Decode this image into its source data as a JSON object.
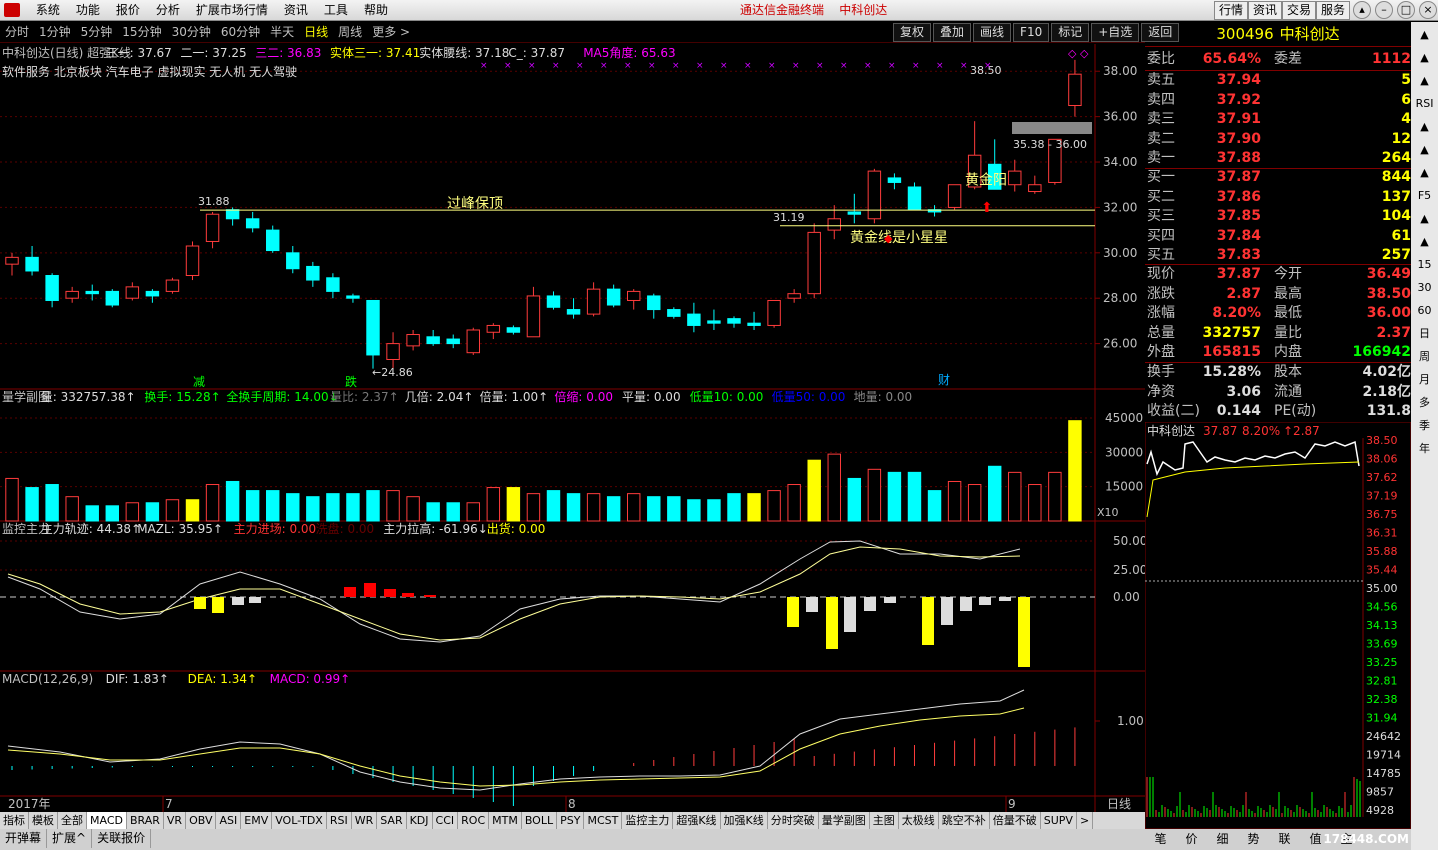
{
  "menu": [
    "系统",
    "功能",
    "报价",
    "分析",
    "扩展市场行情",
    "资讯",
    "工具",
    "帮助"
  ],
  "center_title": "通达信金融终端",
  "center_stock": "中科创达",
  "right_buttons": [
    "行情",
    "资讯",
    "交易",
    "服务"
  ],
  "periods": [
    "分时",
    "1分钟",
    "5分钟",
    "15分钟",
    "30分钟",
    "60分钟",
    "半天",
    "日线",
    "周线",
    "更多 >"
  ],
  "active_period": "日线",
  "tools": [
    "复权",
    "叠加",
    "画线",
    "F10",
    "标记",
    "+自选",
    "返回"
  ],
  "main_header": [
    {
      "t": "中科创达(日线) 超强K线",
      "c": "#c0c0c0"
    },
    {
      "t": "三一: 37.67",
      "c": "#ddd"
    },
    {
      "t": "二一: 37.25",
      "c": "#ddd"
    },
    {
      "t": "三二: 36.83",
      "c": "#f0f"
    },
    {
      "t": "实体三一: 37.41",
      "c": "#ff0"
    },
    {
      "t": "实体腰线: 37.18",
      "c": "#ddd"
    },
    {
      "t": "C_: 37.87",
      "c": "#ddd"
    },
    {
      "t": "MA5角度: 65.63",
      "c": "#f0f"
    }
  ],
  "concepts": "软件服务  北京板块  汽车电子  虚拟现实  无人机  无人驾驶",
  "annotations": {
    "peak": "31.88",
    "guofeng": "过峰保顶",
    "gold_yang": "黄金阳",
    "gold_line": "黄金线是小星星",
    "p3119": "31.19",
    "p2486": "←24.86",
    "p3850": "38.50",
    "range": "35.38 - 36.00",
    "jian": "减",
    "die": "跌",
    "cai": "财"
  },
  "price_axis": [
    "38.00",
    "36.00",
    "34.00",
    "32.00",
    "30.00",
    "28.00",
    "26.00"
  ],
  "vol_header": [
    {
      "t": "量学副图",
      "c": "#c0c0c0"
    },
    {
      "t": "量: 332757.38↑",
      "c": "#ddd"
    },
    {
      "t": "换手: 15.28↑",
      "c": "#0f0"
    },
    {
      "t": "全换手周期: 14.00↓",
      "c": "#0f0"
    },
    {
      "t": "量比: 2.37↑",
      "c": "#777"
    },
    {
      "t": "几倍: 2.04↑",
      "c": "#ddd"
    },
    {
      "t": "倍量: 1.00↑",
      "c": "#ddd"
    },
    {
      "t": "倍缩: 0.00",
      "c": "#f0f"
    },
    {
      "t": "平量: 0.00",
      "c": "#ddd"
    },
    {
      "t": "低量10: 0.00",
      "c": "#0f0"
    },
    {
      "t": "低量50: 0.00",
      "c": "#00f"
    },
    {
      "t": "地量: 0.00",
      "c": "#888"
    }
  ],
  "vol_axis": [
    "45000",
    "30000",
    "15000",
    "X10"
  ],
  "ctrl_header": [
    {
      "t": "监控主力",
      "c": "#c0c0c0"
    },
    {
      "t": "主力轨迹: 44.38↑",
      "c": "#ddd"
    },
    {
      "t": "MAZL: 35.95↑",
      "c": "#ddd"
    },
    {
      "t": "主力进场: 0.00",
      "c": "#f33"
    },
    {
      "t": "洗盘: 0.00",
      "c": "#600"
    },
    {
      "t": "主力拉高: -61.96↓",
      "c": "#ddd"
    },
    {
      "t": "出货: 0.00",
      "c": "#ff0"
    }
  ],
  "ctrl_axis": [
    "50.00",
    "25.00",
    "0.00"
  ],
  "macd_header": [
    {
      "t": "MACD(12,26,9)",
      "c": "#c0c0c0"
    },
    {
      "t": "DIF: 1.83↑",
      "c": "#ddd"
    },
    {
      "t": "DEA: 1.34↑",
      "c": "#ff0"
    },
    {
      "t": "MACD: 0.99↑",
      "c": "#f0f"
    }
  ],
  "macd_axis": [
    "1.00"
  ],
  "date_axis": {
    "year": "2017年",
    "m7": "7",
    "m8": "8",
    "m9": "9",
    "period": "日线"
  },
  "indicators": [
    "指标",
    "模板",
    "全部",
    "MACD",
    "BRAR",
    "VR",
    "OBV",
    "ASI",
    "EMV",
    "VOL-TDX",
    "RSI",
    "WR",
    "SAR",
    "KDJ",
    "CCI",
    "ROC",
    "MTM",
    "BOLL",
    "PSY",
    "MCST",
    "监控主力",
    "超强K线",
    "加强K线",
    "分时突破",
    "量学副图",
    "主图",
    "太极线",
    "跳空不补",
    "倍量不破",
    "SUPV"
  ],
  "active_indicator": "MACD",
  "bottom_tabs": [
    "开弹幕",
    "扩展^",
    "关联报价"
  ],
  "quote": {
    "code": "300496",
    "name": "中科创达",
    "webi": "65.64%",
    "weicha": "1112",
    "sell": [
      [
        "卖五",
        "37.94",
        "5"
      ],
      [
        "卖四",
        "37.92",
        "6"
      ],
      [
        "卖三",
        "37.91",
        "4"
      ],
      [
        "卖二",
        "37.90",
        "12"
      ],
      [
        "卖一",
        "37.88",
        "264"
      ]
    ],
    "buy": [
      [
        "买一",
        "37.87",
        "844"
      ],
      [
        "买二",
        "37.86",
        "137"
      ],
      [
        "买三",
        "37.85",
        "104"
      ],
      [
        "买四",
        "37.84",
        "61"
      ],
      [
        "买五",
        "37.83",
        "257"
      ]
    ],
    "stats": [
      [
        "现价",
        "37.87",
        "今开",
        "36.49"
      ],
      [
        "涨跌",
        "2.87",
        "最高",
        "38.50"
      ],
      [
        "涨幅",
        "8.20%",
        "最低",
        "36.00"
      ],
      [
        "总量",
        "332757",
        "量比",
        "2.37"
      ],
      [
        "外盘",
        "165815",
        "内盘",
        "166942"
      ]
    ],
    "stats2": [
      [
        "换手",
        "15.28%",
        "股本",
        "4.02亿"
      ],
      [
        "净资",
        "3.06",
        "流通",
        "2.18亿"
      ],
      [
        "收益(二)",
        "0.144",
        "PE(动)",
        "131.8"
      ]
    ]
  },
  "mini": {
    "title": "中科创达",
    "price": "37.87",
    "pct": "8.20%",
    "chg": "↑2.87",
    "axis": [
      "38.50",
      "38.06",
      "37.62",
      "37.19",
      "36.75",
      "36.31",
      "35.88",
      "35.44",
      "35.00",
      "34.56",
      "34.13",
      "33.69",
      "33.25",
      "32.81",
      "32.38",
      "31.94",
      "24642",
      "19714",
      "14785",
      "9857",
      "4928"
    ]
  },
  "qtabs": [
    "笔",
    "价",
    "细",
    "势",
    "联",
    "值",
    "主"
  ],
  "rside": [
    "▲",
    "▲",
    "▲",
    "RSI",
    "▲",
    "▲",
    "▲",
    "F5",
    "▲",
    "▲",
    "15",
    "30",
    "60",
    "日",
    "周",
    "月",
    "多",
    "季",
    "年"
  ],
  "watermark": "178448.COM",
  "chart_data": {
    "type": "candlestick",
    "candles": [
      [
        29.5,
        30.0,
        29.0,
        29.8
      ],
      [
        29.8,
        30.3,
        29.0,
        29.2
      ],
      [
        29.0,
        29.1,
        27.6,
        27.9
      ],
      [
        28.0,
        28.5,
        27.8,
        28.3
      ],
      [
        28.3,
        28.6,
        27.9,
        28.2
      ],
      [
        28.3,
        28.4,
        27.6,
        27.7
      ],
      [
        28.0,
        28.7,
        27.9,
        28.5
      ],
      [
        28.3,
        28.4,
        27.8,
        28.1
      ],
      [
        28.3,
        28.9,
        28.2,
        28.8
      ],
      [
        29.0,
        30.5,
        28.8,
        30.3
      ],
      [
        30.5,
        31.8,
        30.2,
        31.7
      ],
      [
        31.9,
        32.0,
        31.2,
        31.5
      ],
      [
        31.5,
        31.8,
        30.9,
        31.1
      ],
      [
        31.0,
        31.2,
        30.0,
        30.1
      ],
      [
        30.0,
        30.3,
        29.1,
        29.3
      ],
      [
        29.4,
        29.6,
        28.5,
        28.8
      ],
      [
        28.9,
        29.1,
        28.0,
        28.3
      ],
      [
        28.1,
        28.2,
        27.8,
        28.0
      ],
      [
        27.9,
        27.9,
        24.9,
        25.5
      ],
      [
        25.3,
        26.5,
        24.9,
        26.0
      ],
      [
        25.9,
        26.6,
        25.7,
        26.4
      ],
      [
        26.3,
        26.6,
        25.9,
        26.0
      ],
      [
        26.2,
        26.4,
        25.8,
        26.0
      ],
      [
        25.6,
        26.7,
        25.5,
        26.6
      ],
      [
        26.5,
        26.9,
        26.2,
        26.8
      ],
      [
        26.7,
        26.8,
        26.4,
        26.5
      ],
      [
        26.3,
        28.5,
        26.3,
        28.1
      ],
      [
        28.1,
        28.3,
        27.5,
        27.6
      ],
      [
        27.5,
        28.0,
        27.1,
        27.3
      ],
      [
        27.3,
        28.7,
        27.2,
        28.4
      ],
      [
        28.4,
        28.6,
        27.6,
        27.7
      ],
      [
        27.9,
        28.4,
        27.5,
        28.3
      ],
      [
        28.1,
        28.2,
        27.1,
        27.5
      ],
      [
        27.5,
        27.6,
        27.1,
        27.2
      ],
      [
        27.3,
        27.8,
        26.5,
        26.8
      ],
      [
        27.0,
        27.5,
        26.6,
        26.9
      ],
      [
        27.1,
        27.2,
        26.7,
        26.9
      ],
      [
        26.9,
        27.4,
        26.6,
        26.8
      ],
      [
        26.8,
        27.9,
        26.7,
        27.9
      ],
      [
        28.0,
        28.4,
        27.8,
        28.2
      ],
      [
        28.2,
        31.3,
        28.0,
        30.9
      ],
      [
        31.0,
        32.1,
        30.6,
        31.5
      ],
      [
        31.8,
        32.6,
        31.3,
        31.7
      ],
      [
        31.5,
        33.7,
        31.3,
        33.6
      ],
      [
        33.3,
        33.5,
        32.8,
        33.1
      ],
      [
        32.9,
        33.1,
        31.9,
        31.9
      ],
      [
        31.9,
        32.1,
        31.6,
        31.8
      ],
      [
        32.0,
        33.0,
        31.9,
        33.0
      ],
      [
        32.9,
        35.8,
        32.8,
        34.3
      ],
      [
        33.9,
        35.0,
        32.8,
        32.8
      ],
      [
        33.0,
        34.1,
        32.7,
        33.6
      ],
      [
        32.7,
        33.4,
        32.6,
        33.0
      ],
      [
        33.1,
        34.9,
        33.0,
        35.0
      ],
      [
        36.49,
        38.5,
        36.0,
        37.87
      ]
    ],
    "volumes": [
      1.4,
      1.1,
      1.2,
      0.8,
      0.5,
      0.5,
      0.6,
      0.6,
      0.7,
      0.7,
      1.2,
      1.3,
      1.0,
      1.0,
      0.9,
      0.8,
      0.9,
      0.9,
      1.0,
      1.0,
      0.8,
      0.6,
      0.6,
      0.6,
      1.1,
      1.1,
      0.9,
      1.0,
      0.9,
      0.9,
      0.8,
      0.9,
      0.8,
      0.8,
      0.7,
      0.7,
      0.9,
      0.9,
      1.0,
      1.2,
      2.0,
      2.2,
      1.4,
      1.7,
      1.6,
      1.6,
      1.0,
      1.3,
      1.2,
      1.8,
      1.6,
      1.2,
      1.6,
      3.3
    ],
    "ylim": [
      24.0,
      39.2
    ]
  }
}
